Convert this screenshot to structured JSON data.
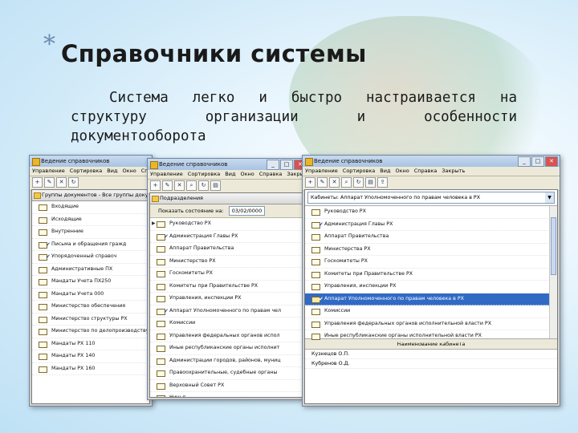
{
  "slide": {
    "bullet": "*",
    "title": "Справочники системы",
    "body_line1": "Система  легко  и  быстро  настраивается  на",
    "body_line2": "структуру  организации  и  особенности",
    "body_line3": "документооборота"
  },
  "win1": {
    "title": "Ведение справочников",
    "menu": [
      "Управление",
      "Сортировка",
      "Вид",
      "Окно",
      "Сп"
    ],
    "sub_title": "Группы документов - Все группы докум",
    "rows": [
      {
        "label": "Входящие",
        "check": false
      },
      {
        "label": "Исходящие",
        "check": false
      },
      {
        "label": "Внутренние",
        "check": false
      },
      {
        "label": "Письма и обращения гражд",
        "check": true
      },
      {
        "label": "Упорядоченный справоч",
        "check": true
      },
      {
        "label": "Административные ПХ",
        "check": false
      },
      {
        "label": "Мандаты Учета ПХ250",
        "check": false
      },
      {
        "label": "Мандаты Учета 000",
        "check": false
      },
      {
        "label": "Министерство обеспечения",
        "check": false
      },
      {
        "label": "Министерство структуры РХ",
        "check": false
      },
      {
        "label": "Министерство по делопроизводству",
        "check": false
      },
      {
        "label": "Мандаты РХ 110",
        "check": false
      },
      {
        "label": "Мандаты РХ 140",
        "check": false
      },
      {
        "label": "Мандаты РХ 160",
        "check": false
      }
    ]
  },
  "win2": {
    "title": "Ведение справочников",
    "menu": [
      "Управление",
      "Сортировка",
      "Вид",
      "Окно",
      "Справка",
      "Закрыть"
    ],
    "sub_title": "Подразделения",
    "filter_label": "Показать состояние на:",
    "filter_date": "03/02/0000",
    "rows": [
      {
        "label": "Руководство РХ",
        "check": false,
        "arrow": true,
        "sel": false
      },
      {
        "label": "Администрация Главы РХ",
        "check": true,
        "arrow": false,
        "sel": false
      },
      {
        "label": "Аппарат Правительства",
        "check": false,
        "arrow": false,
        "sel": false
      },
      {
        "label": "Министерство РХ",
        "check": false,
        "arrow": false,
        "sel": false
      },
      {
        "label": "Госкомитеты РХ",
        "check": false,
        "arrow": false,
        "sel": false
      },
      {
        "label": "Комитеты при Правительстве РХ",
        "check": false,
        "arrow": false,
        "sel": false
      },
      {
        "label": "Управления, инспекции РХ",
        "check": false,
        "arrow": false,
        "sel": false
      },
      {
        "label": "Аппарат Уполномоченного по правам чел",
        "check": true,
        "arrow": false,
        "sel": false
      },
      {
        "label": "Комиссии",
        "check": false,
        "arrow": false,
        "sel": false
      },
      {
        "label": "Управления федеральных органов испол",
        "check": false,
        "arrow": false,
        "sel": false
      },
      {
        "label": "Иные республиканские органы исполнит",
        "check": false,
        "arrow": false,
        "sel": false
      },
      {
        "label": "Администрации городов, районов, муниц",
        "check": false,
        "arrow": false,
        "sel": false
      },
      {
        "label": "Правоохранительные, судебные органы",
        "check": false,
        "arrow": false,
        "sel": false
      },
      {
        "label": "Верховный Совет РХ",
        "check": false,
        "arrow": false,
        "sel": false
      },
      {
        "label": "Ничья",
        "check": false,
        "arrow": false,
        "sel": false
      }
    ]
  },
  "win3": {
    "title": "Ведение справочников",
    "menu": [
      "Управление",
      "Сортировка",
      "Вид",
      "Окно",
      "Справка",
      "Закрыть"
    ],
    "combo": "Кабинеты: Аппарат Уполномоченного по правам человека в РХ",
    "rows": [
      {
        "label": "Руководство РХ",
        "check": false,
        "sel": false
      },
      {
        "label": "Администрация Главы РХ",
        "check": true,
        "sel": false
      },
      {
        "label": "Аппарат Правительства",
        "check": false,
        "sel": false
      },
      {
        "label": "Министерства РХ",
        "check": false,
        "sel": false
      },
      {
        "label": "Госкомитеты РХ",
        "check": false,
        "sel": false
      },
      {
        "label": "Комитеты при Правительстве РХ",
        "check": false,
        "sel": false
      },
      {
        "label": "Управления, инспекции РХ",
        "check": false,
        "sel": false
      },
      {
        "label": "Аппарат Уполномоченного по правам человека в РХ",
        "check": true,
        "sel": true
      },
      {
        "label": "Комиссии",
        "check": false,
        "sel": false
      },
      {
        "label": "Управления федеральных органов исполнительной власти РХ",
        "check": false,
        "sel": false
      },
      {
        "label": "Иные республиканские органы исполнительной власти РХ",
        "check": false,
        "sel": false
      }
    ],
    "panel_header": "Наименование кабинета",
    "panel_rows": [
      "Кузнецов О.П.",
      "Кубренов О.Д."
    ]
  }
}
